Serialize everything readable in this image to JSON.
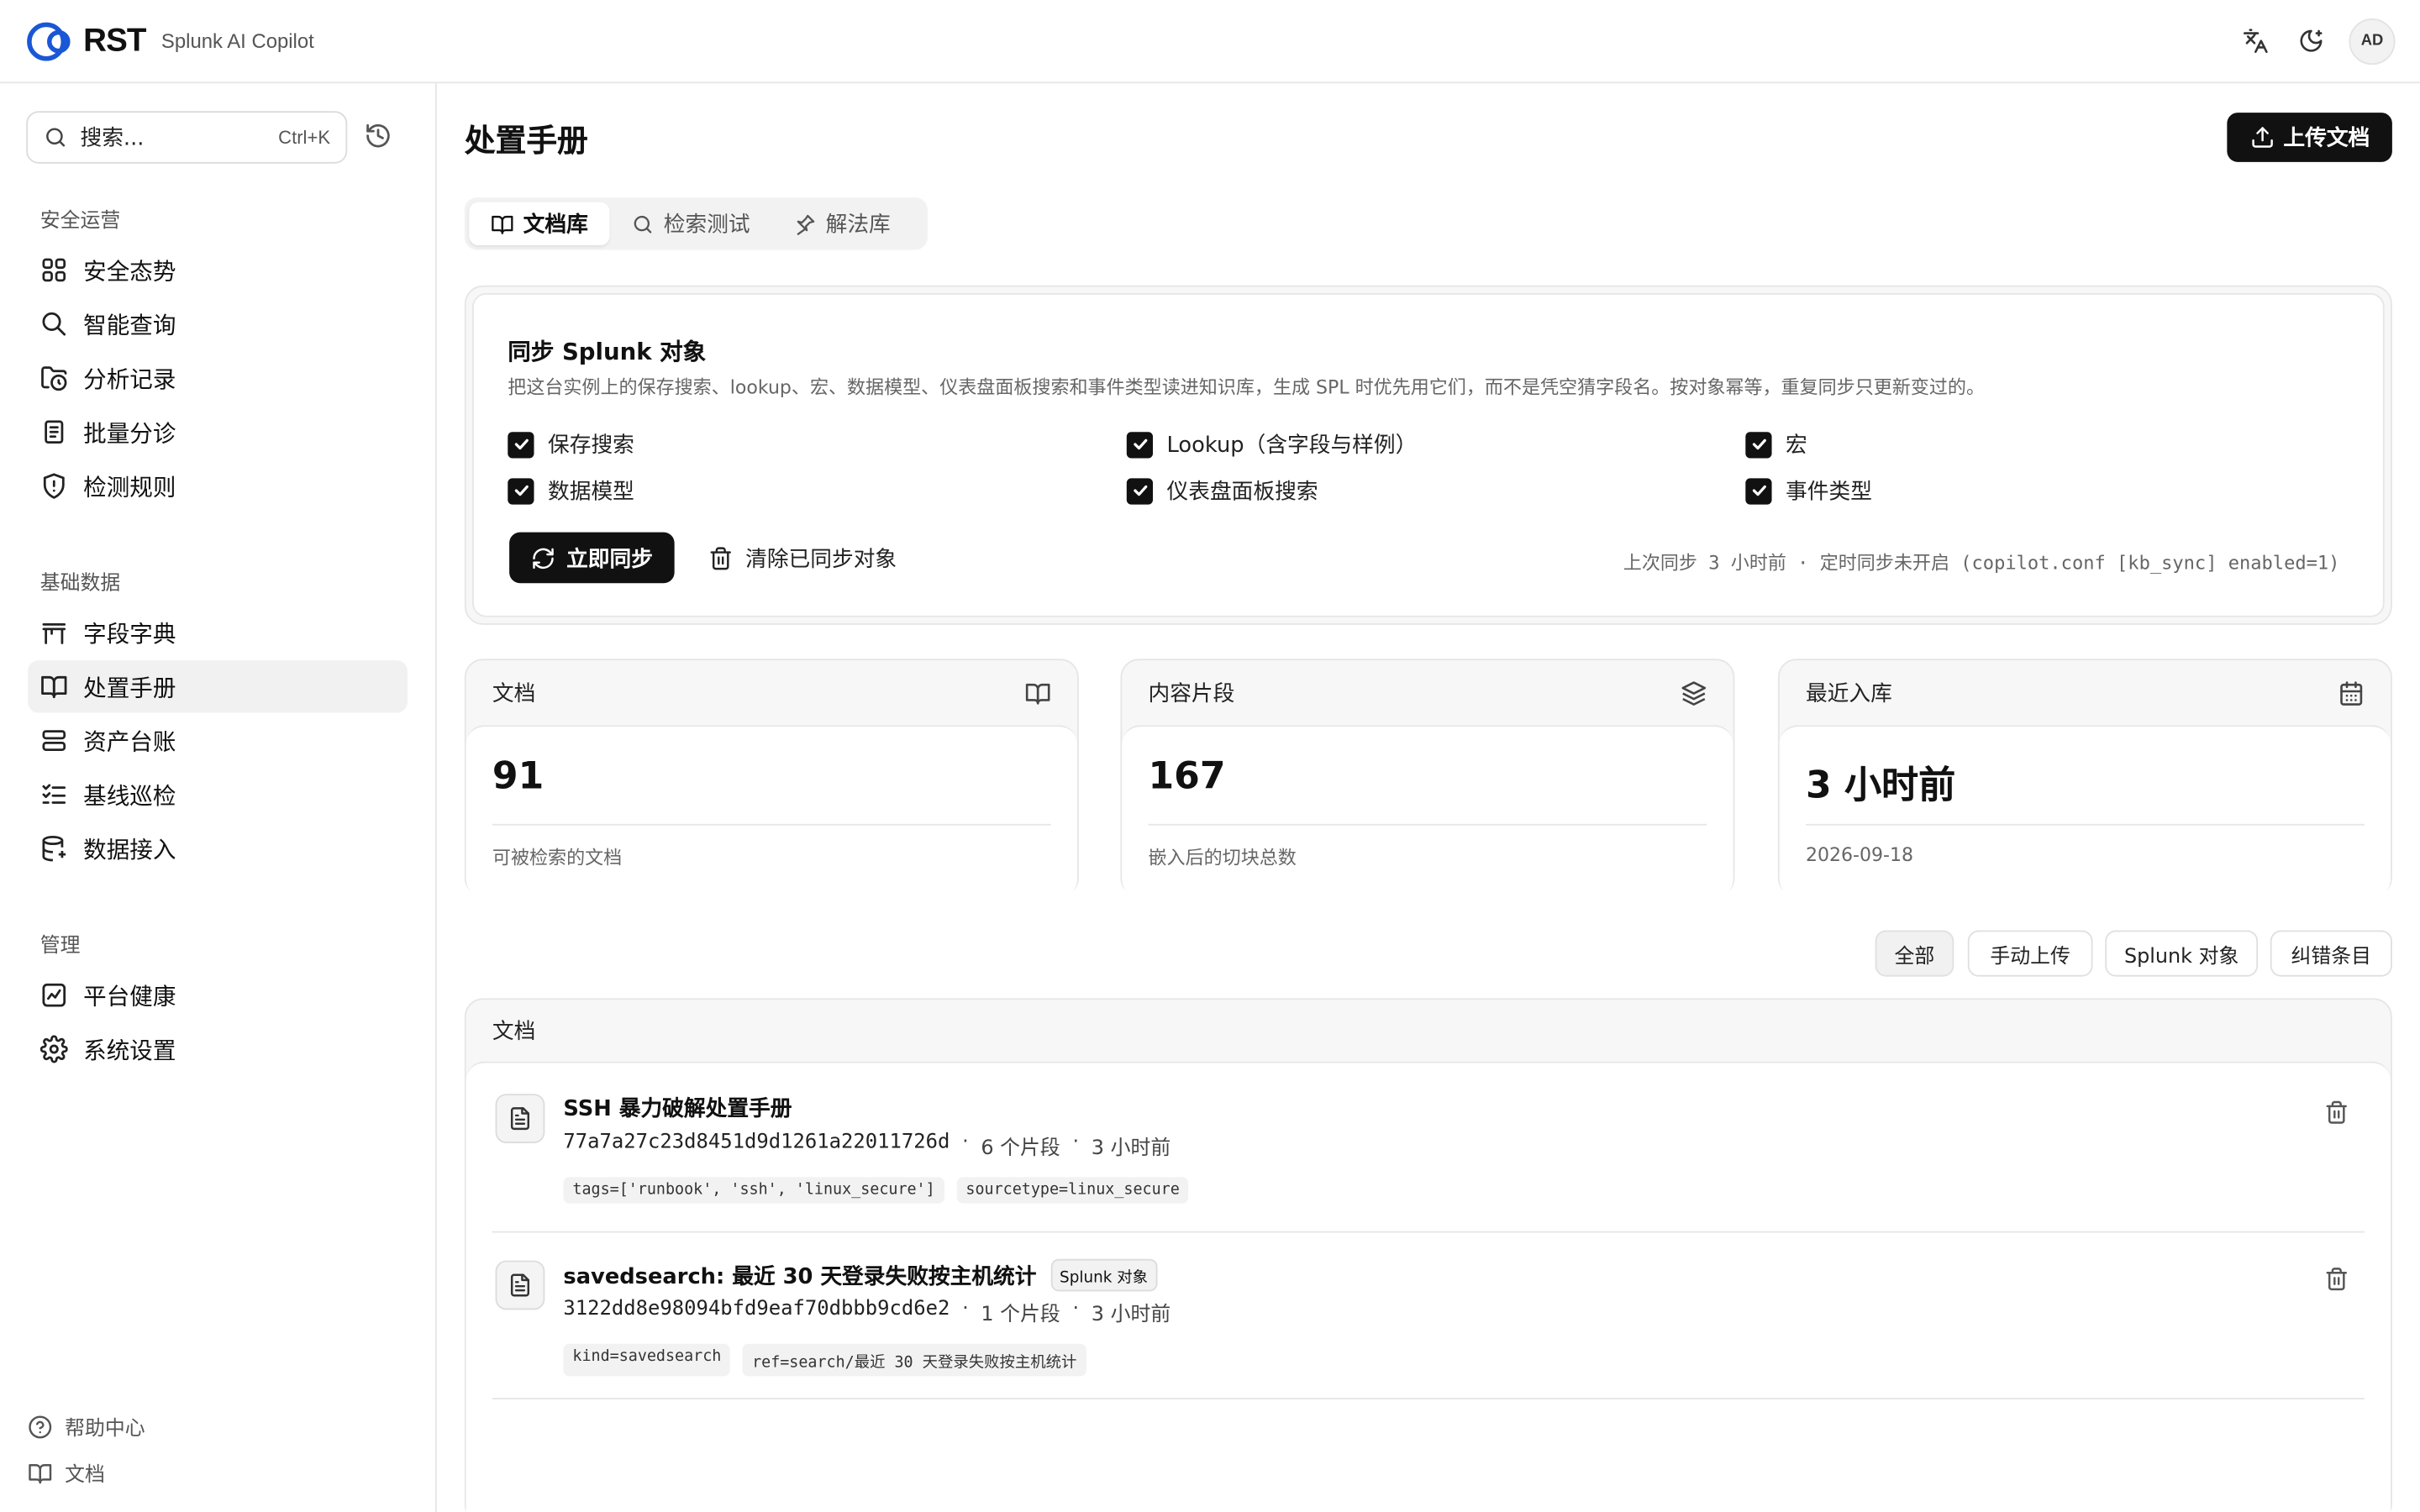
{
  "header": {
    "logo_text": "RST",
    "app_name": "Splunk AI Copilot",
    "avatar_initials": "AD",
    "icons": [
      "translate-icon",
      "theme-toggle-icon"
    ]
  },
  "sidebar": {
    "search_placeholder": "搜索...",
    "search_shortcut": "Ctrl+K",
    "sections": [
      {
        "title": "安全运营",
        "items": [
          {
            "label": "安全态势",
            "icon": "dashboard-grid-icon"
          },
          {
            "label": "智能查询",
            "icon": "search-icon"
          },
          {
            "label": "分析记录",
            "icon": "folder-clock-icon"
          },
          {
            "label": "批量分诊",
            "icon": "clipboard-list-icon"
          },
          {
            "label": "检测规则",
            "icon": "shield-alert-icon"
          }
        ]
      },
      {
        "title": "基础数据",
        "items": [
          {
            "label": "字段字典",
            "icon": "table-icon"
          },
          {
            "label": "处置手册",
            "icon": "book-open-icon",
            "active": true
          },
          {
            "label": "资产台账",
            "icon": "server-icon"
          },
          {
            "label": "基线巡检",
            "icon": "checklist-icon"
          },
          {
            "label": "数据接入",
            "icon": "database-icon"
          }
        ]
      },
      {
        "title": "管理",
        "items": [
          {
            "label": "平台健康",
            "icon": "activity-icon"
          },
          {
            "label": "系统设置",
            "icon": "gear-icon"
          }
        ]
      }
    ],
    "footer": [
      {
        "label": "帮助中心",
        "icon": "help-circle-icon"
      },
      {
        "label": "文档",
        "icon": "book-icon"
      }
    ]
  },
  "main": {
    "title": "处置手册",
    "upload_label": "上传文档",
    "tabs": [
      {
        "label": "文档库",
        "icon": "book-open-icon",
        "active": true
      },
      {
        "label": "检索测试",
        "icon": "search-icon"
      },
      {
        "label": "解法库",
        "icon": "pin-icon"
      }
    ],
    "sync": {
      "title": "同步 Splunk 对象",
      "description": "把这台实例上的保存搜索、lookup、宏、数据模型、仪表盘面板搜索和事件类型读进知识库，生成 SPL 时优先用它们，而不是凭空猜字段名。按对象幂等，重复同步只更新变过的。",
      "options": [
        {
          "label": "保存搜索",
          "checked": true
        },
        {
          "label": "Lookup（含字段与样例）",
          "checked": true
        },
        {
          "label": "宏",
          "checked": true
        },
        {
          "label": "数据模型",
          "checked": true
        },
        {
          "label": "仪表盘面板搜索",
          "checked": true
        },
        {
          "label": "事件类型",
          "checked": true
        }
      ],
      "sync_button": "立即同步",
      "clear_button": "清除已同步对象",
      "meta": "上次同步 3 小时前 · 定时同步未开启 (copilot.conf [kb_sync] enabled=1)"
    },
    "stats": [
      {
        "title": "文档",
        "icon": "book-open-icon",
        "value": "91",
        "sub": "可被检索的文档"
      },
      {
        "title": "内容片段",
        "icon": "layers-icon",
        "value": "167",
        "sub": "嵌入后的切块总数"
      },
      {
        "title": "最近入库",
        "icon": "calendar-icon",
        "value": "3 小时前",
        "sub": "2026-09-18"
      }
    ],
    "filters": [
      {
        "label": "全部",
        "active": true
      },
      {
        "label": "手动上传"
      },
      {
        "label": "Splunk 对象"
      },
      {
        "label": "纠错条目"
      }
    ],
    "docs_title": "文档",
    "documents": [
      {
        "title": "SSH 暴力破解处置手册",
        "badge": "",
        "hash": "77a7a27c23d8451d9d1261a22011726d",
        "chunks": "6 个片段",
        "time": "3 小时前",
        "tags": [
          "tags=['runbook', 'ssh', 'linux_secure']",
          "sourcetype=linux_secure"
        ]
      },
      {
        "title": "savedsearch: 最近 30 天登录失败按主机统计",
        "badge": "Splunk 对象",
        "hash": "3122dd8e98094bfd9eaf70dbbb9cd6e2",
        "chunks": "1 个片段",
        "time": "3 小时前",
        "tags": [
          "kind=savedsearch",
          "ref=search/最近 30 天登录失败按主机统计"
        ]
      }
    ],
    "separator": "·"
  }
}
